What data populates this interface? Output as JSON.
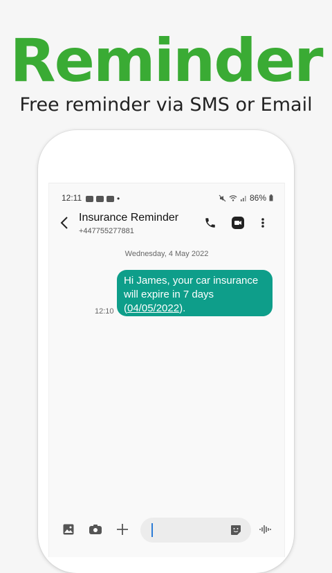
{
  "promo": {
    "headline": "Reminder",
    "subheadline": "Free reminder via SMS or Email",
    "headline_color": "#3aab34",
    "subheadline_color": "#222222"
  },
  "status_bar": {
    "time": "12:11",
    "battery": "86%",
    "extra_indicator": "•"
  },
  "chat": {
    "contact_name": "Insurance Reminder",
    "contact_number": "+447755277881",
    "date_separator": "Wednesday, 4 May 2022",
    "message": {
      "text_before_link": "Hi James, your car insurance will expire in 7 days (",
      "link_text": "04/05/2022",
      "text_after_link": ").",
      "time": "12:10",
      "bubble_color": "#0e9e8a"
    }
  },
  "composer": {
    "input_value": ""
  },
  "icons": {
    "status": [
      "mail-icon",
      "vpn-icon",
      "youtube-icon",
      "mute-icon",
      "wifi-icon",
      "signal-icon",
      "battery-icon"
    ],
    "header": [
      "back-icon",
      "phone-icon",
      "video-call-icon",
      "more-options-icon"
    ],
    "composer": [
      "gallery-icon",
      "camera-icon",
      "plus-icon",
      "sticker-icon",
      "voice-icon"
    ]
  }
}
